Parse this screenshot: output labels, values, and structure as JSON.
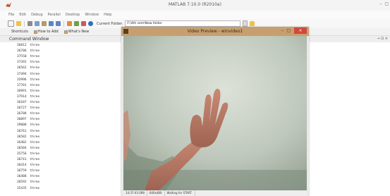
{
  "window": {
    "title": "MATLAB 7.10.0 (R2010a)",
    "controls": [
      "–",
      "▢"
    ]
  },
  "menu": [
    "File",
    "Edit",
    "Debug",
    "Parallel",
    "Desktop",
    "Window",
    "Help"
  ],
  "toolbar": {
    "current_folder_label": "Current Folder:",
    "current_folder_value": "F:\\4th sem\\New folder"
  },
  "shortcuts": {
    "shortcuts_label": "Shortcuts",
    "how_to_add": "How to Add",
    "whats_new": "What's New"
  },
  "command_window": {
    "title": "Command Window",
    "controls": "→ ⊡ ×",
    "rows": [
      {
        "num": "36812",
        "word": "three"
      },
      {
        "num": "36706",
        "word": "three"
      },
      {
        "num": "37550",
        "word": "three"
      },
      {
        "num": "37391",
        "word": "three"
      },
      {
        "num": "36562",
        "word": "three"
      },
      {
        "num": "37494",
        "word": "three"
      },
      {
        "num": "35996",
        "word": "three"
      },
      {
        "num": "37701",
        "word": "three"
      },
      {
        "num": "36991",
        "word": "three"
      },
      {
        "num": "37914",
        "word": "three"
      },
      {
        "num": "36187",
        "word": "three"
      },
      {
        "num": "36727",
        "word": "three"
      },
      {
        "num": "36708",
        "word": "three"
      },
      {
        "num": "36097",
        "word": "three"
      },
      {
        "num": "39008",
        "word": "three"
      },
      {
        "num": "36761",
        "word": "three"
      },
      {
        "num": "36582",
        "word": "three"
      },
      {
        "num": "36402",
        "word": "three"
      },
      {
        "num": "36504",
        "word": "three"
      },
      {
        "num": "35756",
        "word": "three"
      },
      {
        "num": "36741",
        "word": "three"
      },
      {
        "num": "36414",
        "word": "three"
      },
      {
        "num": "36759",
        "word": "three"
      },
      {
        "num": "36488",
        "word": "three"
      },
      {
        "num": "36592",
        "word": "three"
      },
      {
        "num": "35435",
        "word": "three"
      }
    ]
  },
  "video_preview": {
    "title": "Video Preview - winvideo1",
    "status": {
      "time": "14:37:43.098",
      "resolution": "640x480",
      "message": "Waiting for START."
    }
  },
  "colors": {
    "preview_titlebar": "#c79f6f",
    "close_button": "#d04a3c"
  },
  "icons": [
    "matlab-logo-icon",
    "new-file-icon",
    "open-folder-icon",
    "cut-icon",
    "copy-icon",
    "paste-icon",
    "undo-icon",
    "redo-icon",
    "simulink-icon",
    "guide-icon",
    "profiler-icon",
    "help-icon",
    "browse-folder-icon"
  ]
}
